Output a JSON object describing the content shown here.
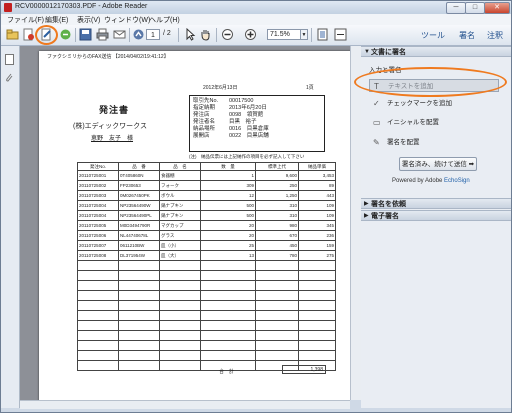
{
  "window": {
    "title": "RCV0000012170303.PDF - Adobe Reader",
    "controls": [
      "─",
      "□",
      "✕"
    ]
  },
  "menu": [
    "ファイル(F)",
    "編集(E)",
    "表示(V)",
    "ウィンドウ(W)",
    "ヘルプ(H)"
  ],
  "toolbar": {
    "page_current": "1",
    "page_total": "/ 2",
    "zoom": "71.5%",
    "tabs": [
      "ツール",
      "署名",
      "注釈"
    ]
  },
  "document": {
    "fax_header": "ファクシミリからのFAX送信 【2014/04/02/19:41:12】",
    "date": "2012年6月13日",
    "page_label": "1頁",
    "title": "発注書",
    "company": "(株)エディックワークス",
    "person": "恵野　友子　様",
    "info": [
      {
        "k": "取引先No.",
        "v": "00017500"
      },
      {
        "k": "指定納期",
        "v": "2013年6月20日"
      },
      {
        "k": "発注店",
        "v": "0098　領賀館"
      },
      {
        "k": "発注者名",
        "v": "目黒　裕子"
      },
      {
        "k": "納品場所",
        "v": "0016　目黒倉庫"
      },
      {
        "k": "展開店",
        "v": "0022　目黒店舗"
      }
    ],
    "note": "(注)　納品伝票には上記納作の項目を必ず記入して下さい",
    "columns": [
      "発注No.",
      "品　番",
      "品　名",
      "数　量",
      "標準上代",
      "納品単価"
    ],
    "rows": [
      [
        "20110725001",
        "0T405860N",
        "食器棚",
        "1",
        "9,600",
        "3,453"
      ],
      [
        "20110725002",
        "FP230653",
        "フォーク",
        "309",
        "250",
        "89"
      ],
      [
        "20110725003",
        "0M0267450PK",
        "ボウル",
        "12",
        "1,250",
        "443"
      ],
      [
        "20110725004",
        "NP23564490W",
        "鍋ナプキン",
        "500",
        "310",
        "109"
      ],
      [
        "20110725004",
        "NP23564490PL",
        "鍋ナプキン",
        "500",
        "310",
        "109"
      ],
      [
        "20110725005",
        "M0D3494790R",
        "マグカップ",
        "20",
        "980",
        "345"
      ],
      [
        "20110725006",
        "NL44740678L",
        "グラス",
        "20",
        "670",
        "236"
      ],
      [
        "20110725007",
        "0611210BW",
        "皿（小）",
        "25",
        "450",
        "159"
      ],
      [
        "20110725008",
        "DL371954W",
        "皿（大）",
        "13",
        "780",
        "275"
      ],
      [
        "",
        "",
        "",
        "",
        "",
        ""
      ],
      [
        "",
        "",
        "",
        "",
        "",
        ""
      ],
      [
        "",
        "",
        "",
        "",
        "",
        ""
      ],
      [
        "",
        "",
        "",
        "",
        "",
        ""
      ],
      [
        "",
        "",
        "",
        "",
        "",
        ""
      ],
      [
        "",
        "",
        "",
        "",
        "",
        ""
      ],
      [
        "",
        "",
        "",
        "",
        "",
        ""
      ],
      [
        "",
        "",
        "",
        "",
        "",
        ""
      ],
      [
        "",
        "",
        "",
        "",
        "",
        ""
      ],
      [
        "",
        "",
        "",
        "",
        "",
        ""
      ],
      [
        "",
        "",
        "",
        "",
        "",
        ""
      ]
    ],
    "total_label": "合　計",
    "total_value": "1,398"
  },
  "right_panel": {
    "section1": "文書に署名",
    "sub_label": "入力と署名",
    "tools": [
      "テキストを追加",
      "チェックマークを追加",
      "イニシャルを配置",
      "署名を配置"
    ],
    "send_button": "署名済み、続けて送信 ➡",
    "powered_by": "Powered by Adobe",
    "powered_brand": "EchoSign",
    "section2": "署名を依頼",
    "section3": "電子署名"
  },
  "colors": {
    "highlight": "#ef7a1f",
    "link": "#1f4e8c"
  }
}
